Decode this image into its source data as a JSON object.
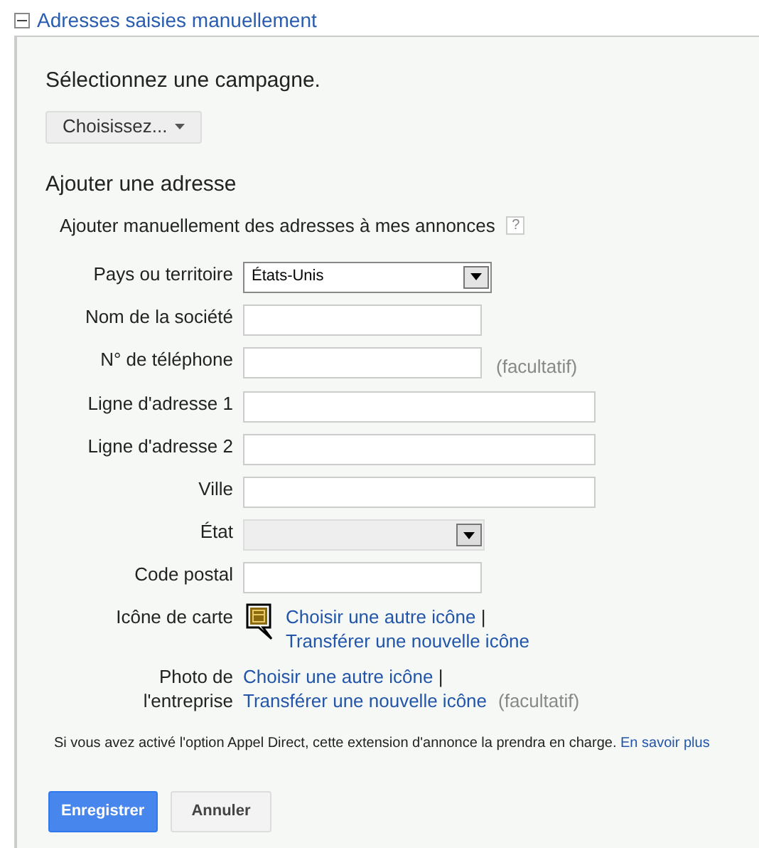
{
  "section": {
    "title": "Adresses saisies manuellement",
    "expanded": true
  },
  "campaign": {
    "prompt": "Sélectionnez une campagne.",
    "button": "Choisissez..."
  },
  "add": {
    "heading": "Ajouter une adresse",
    "option": "Ajouter manuellement des adresses à mes annonces",
    "help": "?"
  },
  "fields": [
    {
      "kind": "select",
      "label": "Pays ou territoire",
      "value": "États-Unis",
      "disabled": false
    },
    {
      "kind": "text",
      "label": "Nom de la société"
    },
    {
      "kind": "text",
      "label": "N° de téléphone",
      "note": "(facultatif)"
    },
    {
      "kind": "text",
      "label": "Ligne d'adresse 1"
    },
    {
      "kind": "text",
      "label": "Ligne d'adresse 2"
    },
    {
      "kind": "text",
      "label": "Ville"
    },
    {
      "kind": "select",
      "label": "État",
      "disabled": true
    },
    {
      "kind": "text",
      "label": "Code postal"
    },
    {
      "kind": "links",
      "label": "Icône de carte",
      "icon": true,
      "link1": "Choisir une autre icône",
      "separator": "|",
      "link2": "Transférer une nouvelle icône"
    },
    {
      "kind": "links",
      "label": "Photo de l'entreprise",
      "icon": false,
      "link1": "Choisir une autre icône",
      "separator": "|",
      "link2": "Transférer une nouvelle icône",
      "note": "(facultatif)"
    }
  ],
  "notice": {
    "text": "Si vous avez activé l'option Appel Direct, cette extension d'annonce la prendra en charge.",
    "link": "En savoir plus"
  },
  "buttons": [
    {
      "kind": "primary",
      "label": "Enregistrer"
    },
    {
      "kind": "secondary",
      "label": "Annuler"
    }
  ]
}
